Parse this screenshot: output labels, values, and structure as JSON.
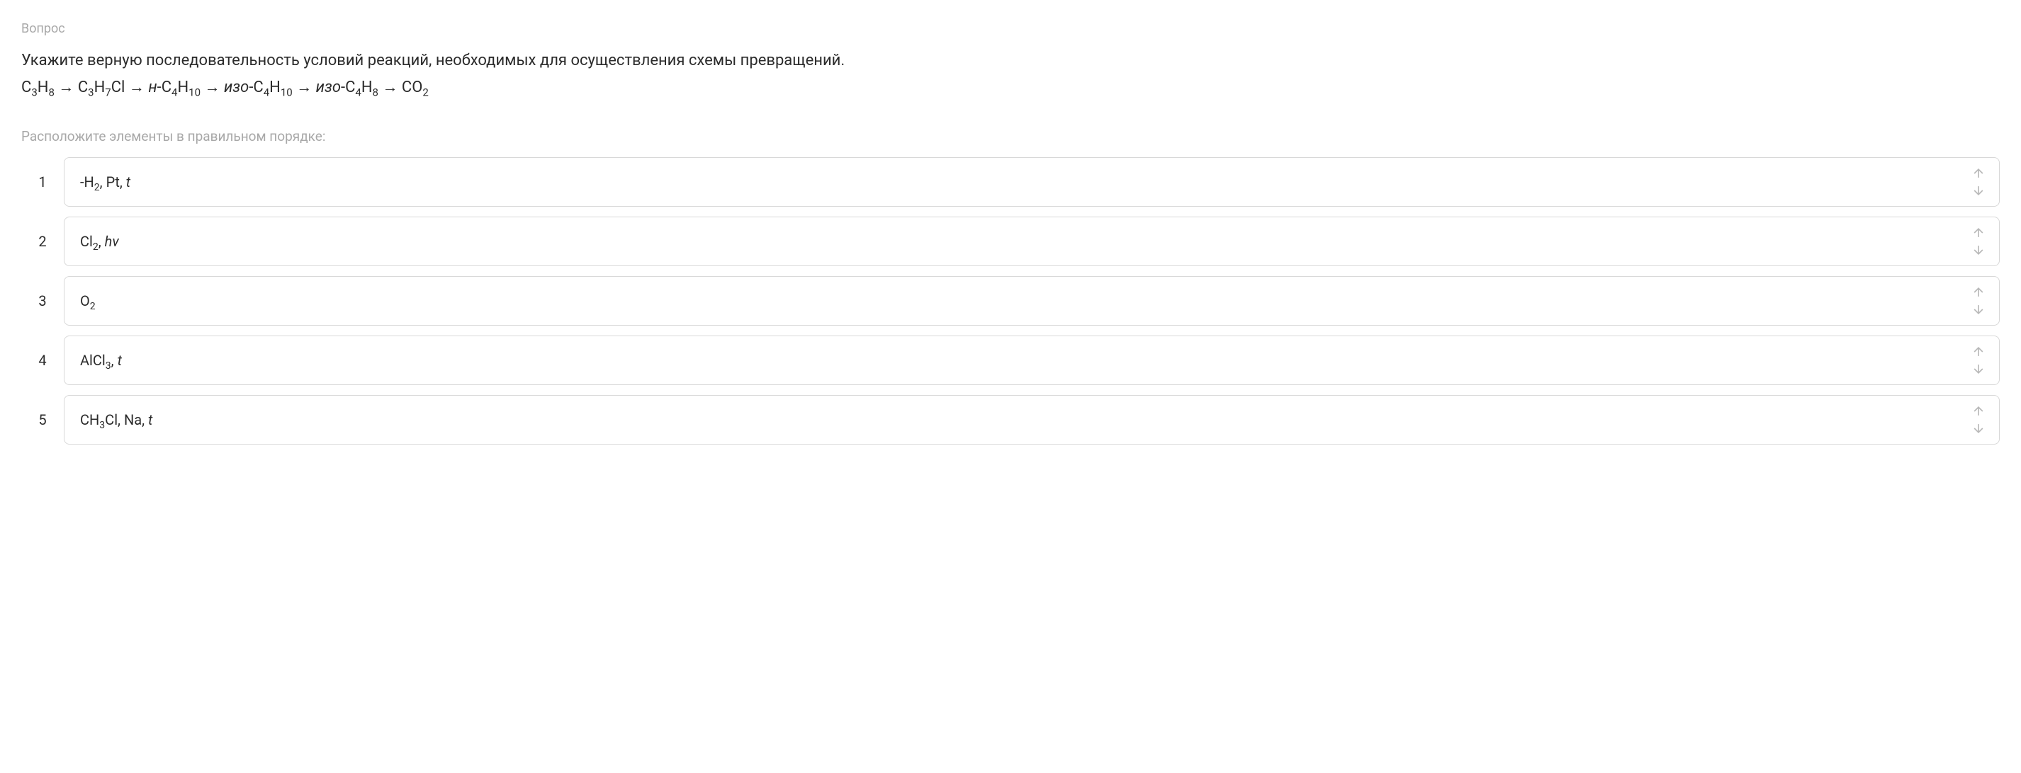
{
  "question_label": "Вопрос",
  "question_text": "Укажите верную последовательность условий реакций, необходимых для осуществления схемы превращений.",
  "arrange_label": "Расположите элементы в правильном порядке:",
  "formula_html": "C<sub>3</sub>H<sub>8</sub> → C<sub>3</sub>H<sub>7</sub>Cl → <span class=\"italic\">н</span>-C<sub>4</sub>H<sub>10</sub> → <span class=\"italic\">изо</span>-C<sub>4</sub>H<sub>10</sub> → <span class=\"italic\">изо</span>-C<sub>4</sub>H<sub>8</sub> → CO<sub>2</sub>",
  "items": [
    {
      "number": "1",
      "html": "-H<sub>2</sub>, Pt, <span class=\"italic\">t</span>"
    },
    {
      "number": "2",
      "html": "Cl<sub>2</sub>, <span class=\"italic\">hv</span>"
    },
    {
      "number": "3",
      "html": "O<sub>2</sub>"
    },
    {
      "number": "4",
      "html": "AlCl<sub>3</sub>, <span class=\"italic\">t</span>"
    },
    {
      "number": "5",
      "html": "CH<sub>3</sub>Cl, Na, <span class=\"italic\">t</span>"
    }
  ]
}
